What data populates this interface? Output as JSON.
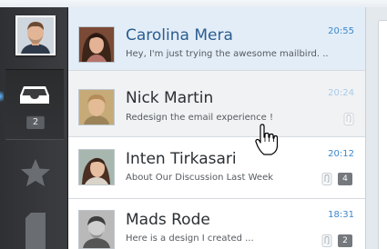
{
  "sidebar": {
    "inbox_badge": "2"
  },
  "messages": [
    {
      "name": "Carolina Mera",
      "subject": "Hey, I'm just trying the awesome mailbird. ..",
      "time": "20:55"
    },
    {
      "name": "Nick Martin",
      "subject": "Redesign the email experience !",
      "time": "20:24"
    },
    {
      "name": "Inten Tirkasari",
      "subject": "About Our Discussion Last Week",
      "time": "20:12",
      "count": "4"
    },
    {
      "name": "Mads Rode",
      "subject": "Here is a design I created ...",
      "time": "18:31",
      "count": "2"
    }
  ],
  "icons": {
    "profile": "avatar",
    "inbox": "inbox-tray-icon",
    "starred": "star-icon",
    "drafts": "document-icon",
    "attachment": "paperclip-icon",
    "cursor": "hand-pointer-cursor"
  },
  "colors": {
    "sidebar": "#3a3c3f",
    "selected_row": "#e3edf8",
    "accent": "#3b88cc"
  }
}
